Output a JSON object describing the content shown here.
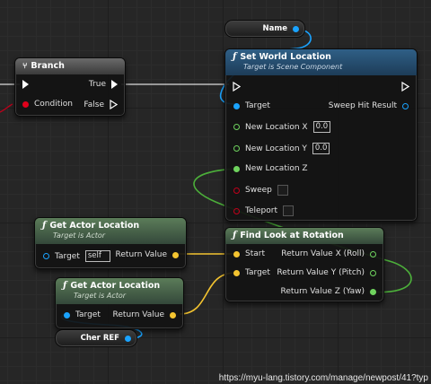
{
  "nodes": {
    "branch": {
      "title": "Branch",
      "icon": "branch-icon",
      "condition_label": "Condition",
      "true_label": "True",
      "false_label": "False"
    },
    "name_var": {
      "label": "Name"
    },
    "set_world_location": {
      "title": "Set World Location",
      "subtitle": "Target is Scene Component",
      "target_label": "Target",
      "sweep_hit_label": "Sweep Hit Result",
      "new_x_label": "New Location X",
      "new_x_value": "0.0",
      "new_y_label": "New Location Y",
      "new_y_value": "0.0",
      "new_z_label": "New Location Z",
      "sweep_label": "Sweep",
      "teleport_label": "Teleport"
    },
    "get_actor_location_1": {
      "title": "Get Actor Location",
      "subtitle": "Target is Actor",
      "target_label": "Target",
      "target_value": "self",
      "return_label": "Return Value"
    },
    "find_look_at_rotation": {
      "title": "Find Look at Rotation",
      "start_label": "Start",
      "target_label": "Target",
      "roll_label": "Return Value X (Roll)",
      "pitch_label": "Return Value Y (Pitch)",
      "yaw_label": "Return Value Z (Yaw)"
    },
    "get_actor_location_2": {
      "title": "Get Actor Location",
      "subtitle": "Target is Actor",
      "target_label": "Target",
      "return_label": "Return Value"
    },
    "cher_ref_var": {
      "label": "Cher REF"
    }
  },
  "watermark": "https://myu-lang.tistory.com/manage/newpost/41?typ",
  "colors": {
    "exec": "#ffffff",
    "object": "#1aa3ff",
    "boolean": "#e0001b",
    "float": "#6fd35e",
    "vector": "#f4c430"
  }
}
